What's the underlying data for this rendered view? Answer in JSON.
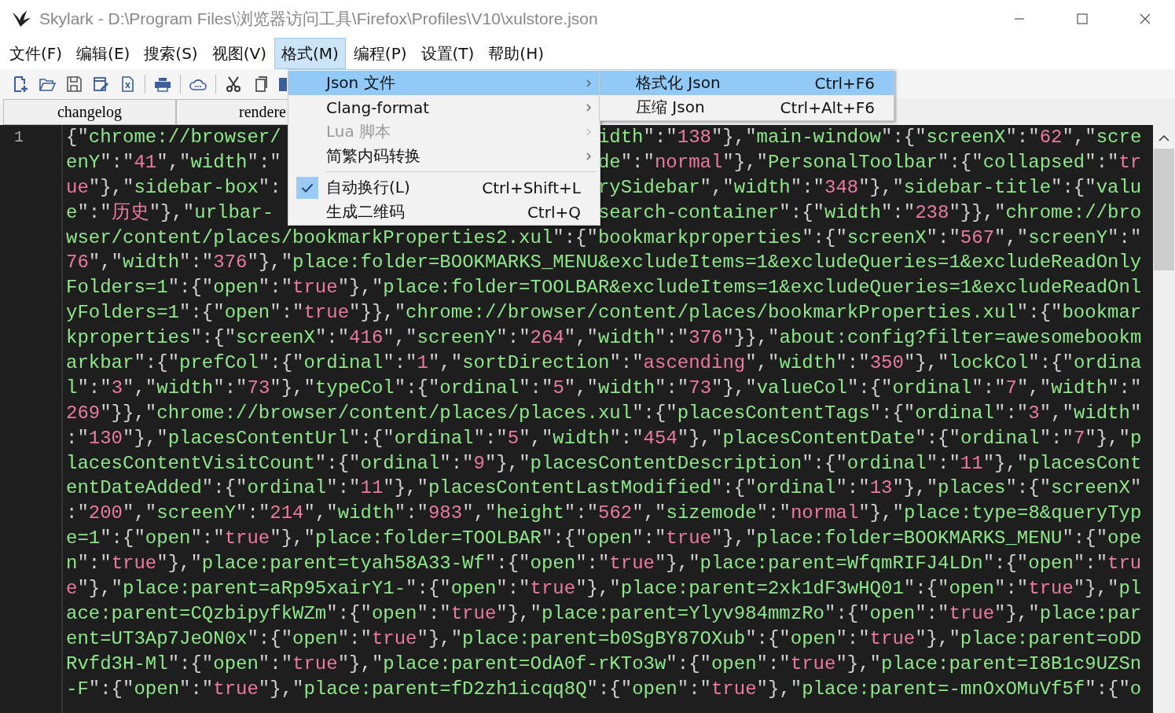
{
  "window": {
    "title": "Skylark - D:\\Program Files\\浏览器访问工具\\Firefox\\Profiles\\V10\\xulstore.json"
  },
  "menubar": [
    {
      "label": "文件(F)",
      "selected": false
    },
    {
      "label": "编辑(E)",
      "selected": false
    },
    {
      "label": "搜索(S)",
      "selected": false
    },
    {
      "label": "视图(V)",
      "selected": false
    },
    {
      "label": "格式(M)",
      "selected": true
    },
    {
      "label": "编程(P)",
      "selected": false
    },
    {
      "label": "设置(T)",
      "selected": false
    },
    {
      "label": "帮助(H)",
      "selected": false
    }
  ],
  "tabs": [
    {
      "label": "changelog"
    },
    {
      "label": "rendere"
    }
  ],
  "menu": {
    "items": [
      {
        "kind": "item",
        "label": "Json 文件",
        "submenu": true,
        "selected": true,
        "disabled": false,
        "checked": false
      },
      {
        "kind": "item",
        "label": "Clang-format",
        "submenu": true,
        "selected": false,
        "disabled": false,
        "checked": false
      },
      {
        "kind": "item",
        "label": "Lua 脚本",
        "submenu": true,
        "selected": false,
        "disabled": true,
        "checked": false
      },
      {
        "kind": "item",
        "label": "简繁内码转换",
        "submenu": true,
        "selected": false,
        "disabled": false,
        "checked": false
      },
      {
        "kind": "separator"
      },
      {
        "kind": "item",
        "label": "自动换行(L)",
        "shortcut": "Ctrl+Shift+L",
        "submenu": false,
        "selected": false,
        "disabled": false,
        "checked": true
      },
      {
        "kind": "item",
        "label": "生成二维码",
        "shortcut": "Ctrl+Q",
        "submenu": false,
        "selected": false,
        "disabled": false,
        "checked": false
      }
    ],
    "submenu": [
      {
        "label": "格式化 Json",
        "shortcut": "Ctrl+F6",
        "selected": true
      },
      {
        "label": "压缩 Json",
        "shortcut": "Ctrl+Alt+F6",
        "selected": false
      }
    ]
  },
  "editor": {
    "lines": [
      {
        "number": "1",
        "left": "{\"chrome://browser/",
        "right": "idth\":\"138\"},\"main-window\":{\"screenX\":\"62\",\"scre"
      },
      {
        "left": "enY\":\"41\",\"width\":\"",
        "right": "de\":\"normal\"},\"PersonalToolbar\":{\"collapsed\":\"tr"
      },
      {
        "left": "ue\"},\"sidebar-box\":",
        "right": "rySidebar\",\"width\":\"348\"},\"sidebar-title\":{\"valu"
      },
      {
        "left": "e\":\"历史\"},\"urlbar-",
        "right": "search-container\":{\"width\":\"238\"}},\"chrome://bro"
      },
      {
        "text": "wser/content/places/bookmarkProperties2.xul\":{\"bookmarkproperties\":{\"screenX\":\"567\",\"screenY\":\""
      },
      {
        "text": "76\",\"width\":\"376\"},\"place:folder=BOOKMARKS_MENU&excludeItems=1&excludeQueries=1&excludeReadOnly"
      },
      {
        "text": "Folders=1\":{\"open\":\"true\"},\"place:folder=TOOLBAR&excludeItems=1&excludeQueries=1&excludeReadOnl"
      },
      {
        "text": "yFolders=1\":{\"open\":\"true\"}},\"chrome://browser/content/places/bookmarkProperties.xul\":{\"bookmar"
      },
      {
        "text": "kproperties\":{\"screenX\":\"416\",\"screenY\":\"264\",\"width\":\"376\"}},\"about:config?filter=awesomebookm"
      },
      {
        "text": "arkbar\":{\"prefCol\":{\"ordinal\":\"1\",\"sortDirection\":\"ascending\",\"width\":\"350\"},\"lockCol\":{\"ordina"
      },
      {
        "text": "l\":\"3\",\"width\":\"73\"},\"typeCol\":{\"ordinal\":\"5\",\"width\":\"73\"},\"valueCol\":{\"ordinal\":\"7\",\"width\":\""
      },
      {
        "text": "269\"}},\"chrome://browser/content/places/places.xul\":{\"placesContentTags\":{\"ordinal\":\"3\",\"width\""
      },
      {
        "text": ":\"130\"},\"placesContentUrl\":{\"ordinal\":\"5\",\"width\":\"454\"},\"placesContentDate\":{\"ordinal\":\"7\"},\"p"
      },
      {
        "text": "lacesContentVisitCount\":{\"ordinal\":\"9\"},\"placesContentDescription\":{\"ordinal\":\"11\"},\"placesCont"
      },
      {
        "text": "entDateAdded\":{\"ordinal\":\"11\"},\"placesContentLastModified\":{\"ordinal\":\"13\"},\"places\":{\"screenX\""
      },
      {
        "text": ":\"200\",\"screenY\":\"214\",\"width\":\"983\",\"height\":\"562\",\"sizemode\":\"normal\"},\"place:type=8&queryTyp"
      },
      {
        "text": "e=1\":{\"open\":\"true\"},\"place:folder=TOOLBAR\":{\"open\":\"true\"},\"place:folder=BOOKMARKS_MENU\":{\"ope"
      },
      {
        "text": "n\":\"true\"},\"place:parent=tyah58A33-Wf\":{\"open\":\"true\"},\"place:parent=WfqmRIFJ4LDn\":{\"open\":\"tru"
      },
      {
        "text": "e\"},\"place:parent=aRp95xairY1-\":{\"open\":\"true\"},\"place:parent=2xk1dF3wHQ01\":{\"open\":\"true\"},\"pl"
      },
      {
        "text": "ace:parent=CQzbipyfkWZm\":{\"open\":\"true\"},\"place:parent=Ylyv984mmzRo\":{\"open\":\"true\"},\"place:par"
      },
      {
        "text": "ent=UT3Ap7JeON0x\":{\"open\":\"true\"},\"place:parent=b0SgBY87OXub\":{\"open\":\"true\"},\"place:parent=oDD"
      },
      {
        "text": "Rvfd3H-Ml\":{\"open\":\"true\"},\"place:parent=OdA0f-rKTo3w\":{\"open\":\"true\"},\"place:parent=I8B1c9UZSn"
      },
      {
        "text": "-F\":{\"open\":\"true\"},\"place:parent=fD2zh1icqq8Q\":{\"open\":\"true\"},\"place:parent=-mnOxOMuVf5f\":{\"o"
      }
    ]
  }
}
